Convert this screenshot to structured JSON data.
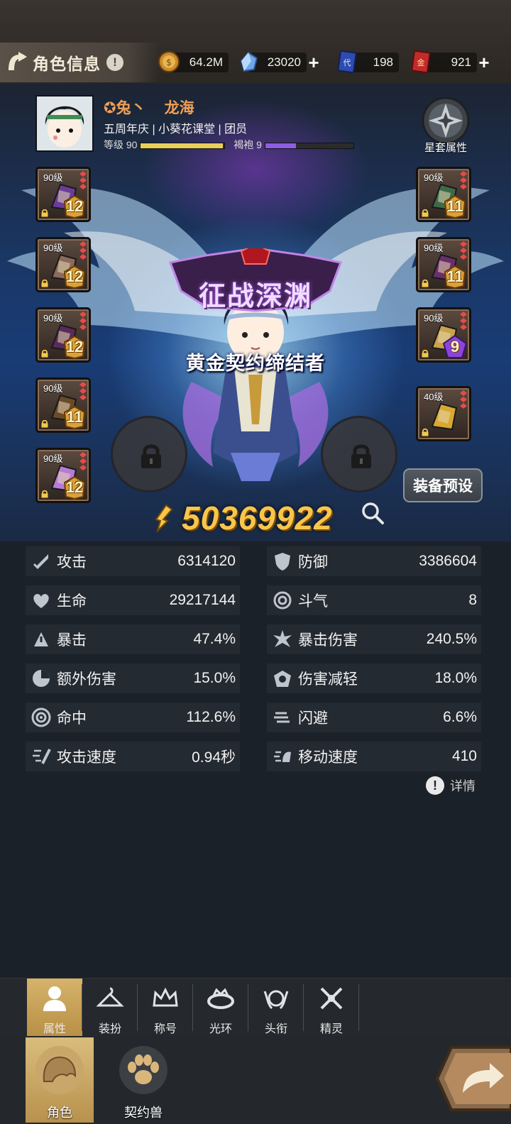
{
  "header": {
    "title": "角色信息",
    "info_glyph": "!",
    "currencies": [
      {
        "name": "gold-coin",
        "value": "64.2M",
        "has_plus": false
      },
      {
        "name": "crystal",
        "value": "23020",
        "has_plus": true
      },
      {
        "name": "blue-ticket",
        "value": "198",
        "has_plus": false
      },
      {
        "name": "red-ticket",
        "value": "921",
        "has_plus": true
      }
    ]
  },
  "profile": {
    "name_prefix": "兔丶",
    "name": "龙海",
    "line": "五周年庆 | 小葵花课堂 | 团员",
    "level_label": "等级 90",
    "level_progress": 0.98,
    "cloak_label": "褐袍 9",
    "cloak_progress": 0.35
  },
  "star_set": {
    "label": "星套属性"
  },
  "equipment": {
    "left": [
      {
        "level": "90级",
        "badge": "12",
        "item": "helmet"
      },
      {
        "level": "90级",
        "badge": "12",
        "item": "shoulder"
      },
      {
        "level": "90级",
        "badge": "12",
        "item": "chest"
      },
      {
        "level": "90级",
        "badge": "11",
        "item": "gloves"
      },
      {
        "level": "90级",
        "badge": "12",
        "item": "cloak"
      }
    ],
    "right": [
      {
        "level": "90级",
        "badge": "11",
        "item": "weapon"
      },
      {
        "level": "90级",
        "badge": "11",
        "item": "offhand"
      },
      {
        "level": "90级",
        "badge": "9",
        "item": "necklace"
      },
      {
        "level": "40级",
        "badge": "",
        "item": "ring"
      }
    ]
  },
  "hero": {
    "title_banner": "征战深渊",
    "subtitle": "黄金契约缔结者",
    "preset_button": "装备预设",
    "power": "50369922"
  },
  "stats": [
    {
      "name": "攻击",
      "value": "6314120",
      "icon": "sword-icon"
    },
    {
      "name": "防御",
      "value": "3386604",
      "icon": "shield-icon"
    },
    {
      "name": "生命",
      "value": "29217144",
      "icon": "heart-icon"
    },
    {
      "name": "斗气",
      "value": "8",
      "icon": "swirl-icon"
    },
    {
      "name": "暴击",
      "value": "47.4%",
      "icon": "crit-icon"
    },
    {
      "name": "暴击伤害",
      "value": "240.5%",
      "icon": "burst-icon"
    },
    {
      "name": "额外伤害",
      "value": "15.0%",
      "icon": "extra-damage-icon"
    },
    {
      "name": "伤害减轻",
      "value": "18.0%",
      "icon": "damage-reduce-icon"
    },
    {
      "name": "命中",
      "value": "112.6%",
      "icon": "target-icon"
    },
    {
      "name": "闪避",
      "value": "6.6%",
      "icon": "dodge-icon"
    },
    {
      "name": "攻击速度",
      "value": "0.94秒",
      "icon": "attack-speed-icon"
    },
    {
      "name": "移动速度",
      "value": "410",
      "icon": "move-speed-icon"
    }
  ],
  "detail": {
    "label": "详情",
    "glyph": "!"
  },
  "subtabs": [
    {
      "label": "属性",
      "icon": "person-icon",
      "active": true
    },
    {
      "label": "装扮",
      "icon": "hanger-icon",
      "active": false
    },
    {
      "label": "称号",
      "icon": "crown-icon",
      "active": false
    },
    {
      "label": "光环",
      "icon": "halo-icon",
      "active": false
    },
    {
      "label": "头衔",
      "icon": "emblem-icon",
      "active": false
    },
    {
      "label": "精灵",
      "icon": "spirit-icon",
      "active": false
    }
  ],
  "maintabs": [
    {
      "label": "角色",
      "icon": "character-icon",
      "active": true
    },
    {
      "label": "契约兽",
      "icon": "paw-icon",
      "active": false
    }
  ]
}
